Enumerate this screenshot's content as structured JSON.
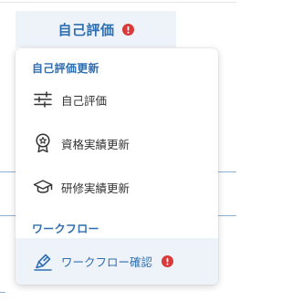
{
  "top_tab": {
    "label": "自己評価",
    "has_alert": true
  },
  "menu": {
    "sections": [
      {
        "header": "自己評価更新",
        "items": [
          {
            "label": "自己評価",
            "icon": "sliders-icon"
          },
          {
            "label": "資格実績更新",
            "icon": "award-icon"
          },
          {
            "label": "研修実績更新",
            "icon": "graduation-cap-icon"
          }
        ]
      },
      {
        "header": "ワークフロー",
        "items": [
          {
            "label": "ワークフロー確認",
            "icon": "workflow-pen-icon",
            "active": true,
            "has_alert": true
          }
        ]
      }
    ]
  },
  "colors": {
    "accent": "#2f6fb1",
    "alert": "#d93a3a",
    "active_background": "#eef3fa",
    "text": "#333333"
  }
}
